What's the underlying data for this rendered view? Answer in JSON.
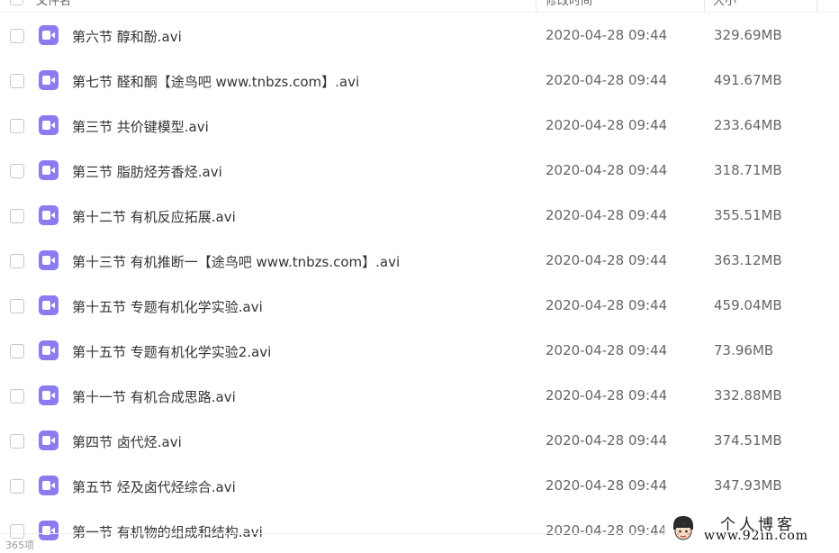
{
  "header": {
    "name_label": "文件名",
    "time_label": "修改时间",
    "size_label": "大小"
  },
  "files": [
    {
      "name": "第六节 醇和酚.avi",
      "time": "2020-04-28 09:44",
      "size": "329.69MB"
    },
    {
      "name": "第七节 醛和酮【途鸟吧 www.tnbzs.com】.avi",
      "time": "2020-04-28 09:44",
      "size": "491.67MB"
    },
    {
      "name": "第三节 共价键模型.avi",
      "time": "2020-04-28 09:44",
      "size": "233.64MB"
    },
    {
      "name": "第三节 脂肪烃芳香烃.avi",
      "time": "2020-04-28 09:44",
      "size": "318.71MB"
    },
    {
      "name": "第十二节 有机反应拓展.avi",
      "time": "2020-04-28 09:44",
      "size": "355.51MB"
    },
    {
      "name": "第十三节 有机推断一【途鸟吧 www.tnbzs.com】.avi",
      "time": "2020-04-28 09:44",
      "size": "363.12MB"
    },
    {
      "name": "第十五节 专题有机化学实验.avi",
      "time": "2020-04-28 09:44",
      "size": "459.04MB"
    },
    {
      "name": "第十五节 专题有机化学实验2.avi",
      "time": "2020-04-28 09:44",
      "size": "73.96MB"
    },
    {
      "name": "第十一节 有机合成思路.avi",
      "time": "2020-04-28 09:44",
      "size": "332.88MB"
    },
    {
      "name": "第四节 卤代烃.avi",
      "time": "2020-04-28 09:44",
      "size": "374.51MB"
    },
    {
      "name": "第五节 烃及卤代烃综合.avi",
      "time": "2020-04-28 09:44",
      "size": "347.93MB"
    },
    {
      "name": "第一节 有机物的组成和结构.avi",
      "time": "2020-04-28 09:44",
      "size": ""
    }
  ],
  "footer": {
    "count_text": "365项"
  },
  "watermark": {
    "title": "个人博客",
    "url": "www.92in.com"
  },
  "colors": {
    "icon_bg": "#8a7cf0",
    "text": "#333333",
    "meta_text": "#666666"
  }
}
